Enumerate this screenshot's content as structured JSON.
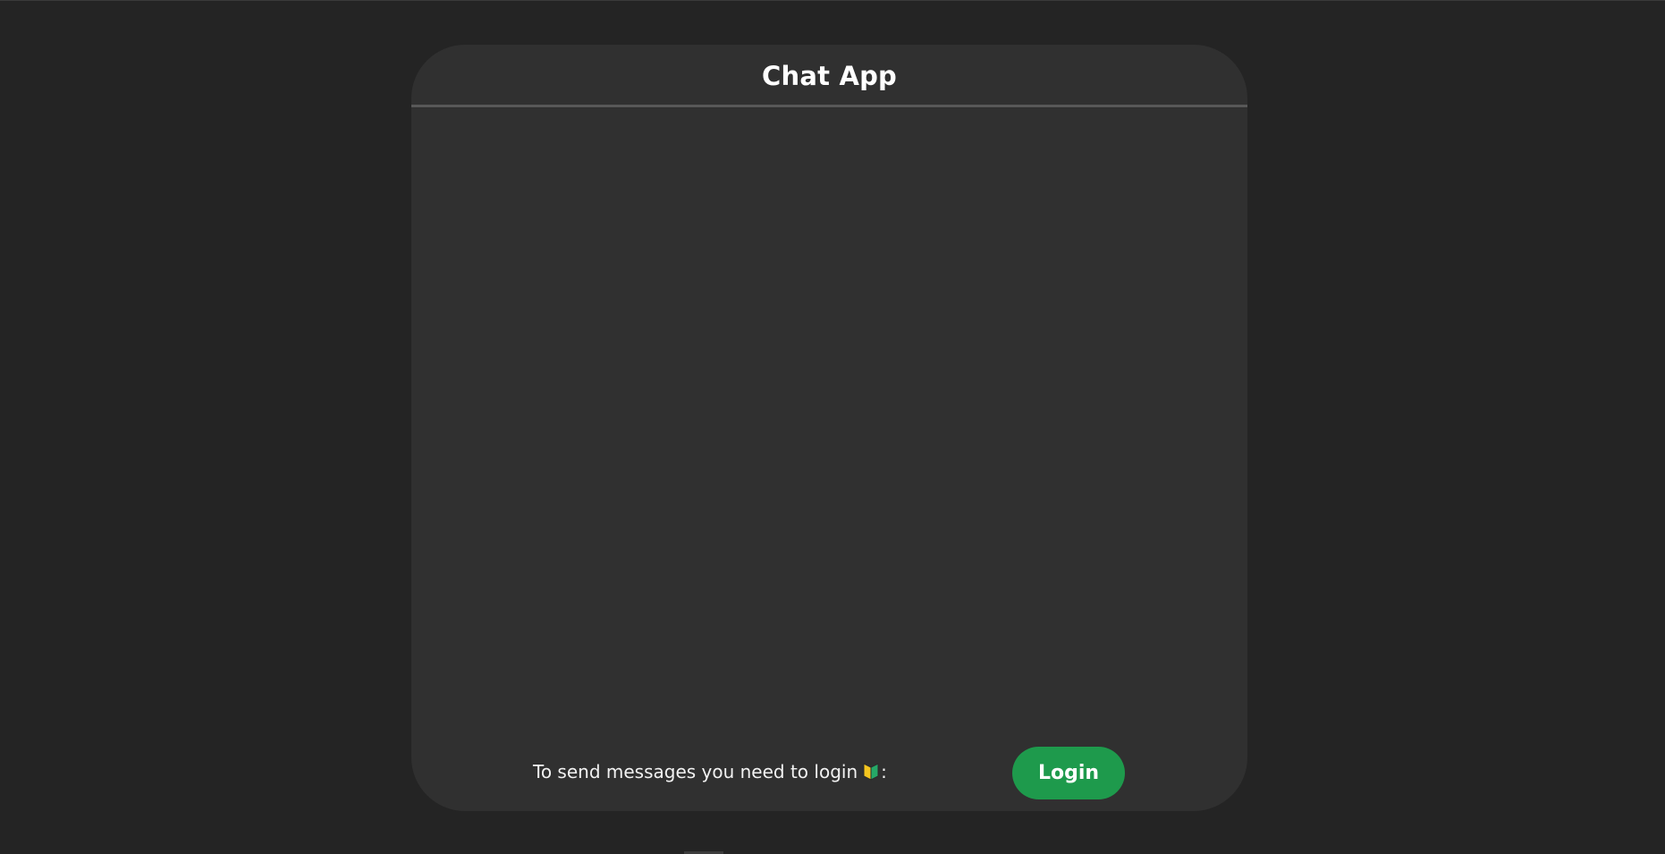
{
  "app": {
    "title": "Chat App"
  },
  "footer": {
    "prompt_text": "To send messages you need to login",
    "prompt_suffix": ":",
    "prompt_icon": "beginner-leaf-icon",
    "login_label": "Login"
  },
  "colors": {
    "page_background": "#242424",
    "card_background": "#303030",
    "header_divider": "#585858",
    "login_button": "#1e9a4c",
    "text": "#ffffff"
  }
}
